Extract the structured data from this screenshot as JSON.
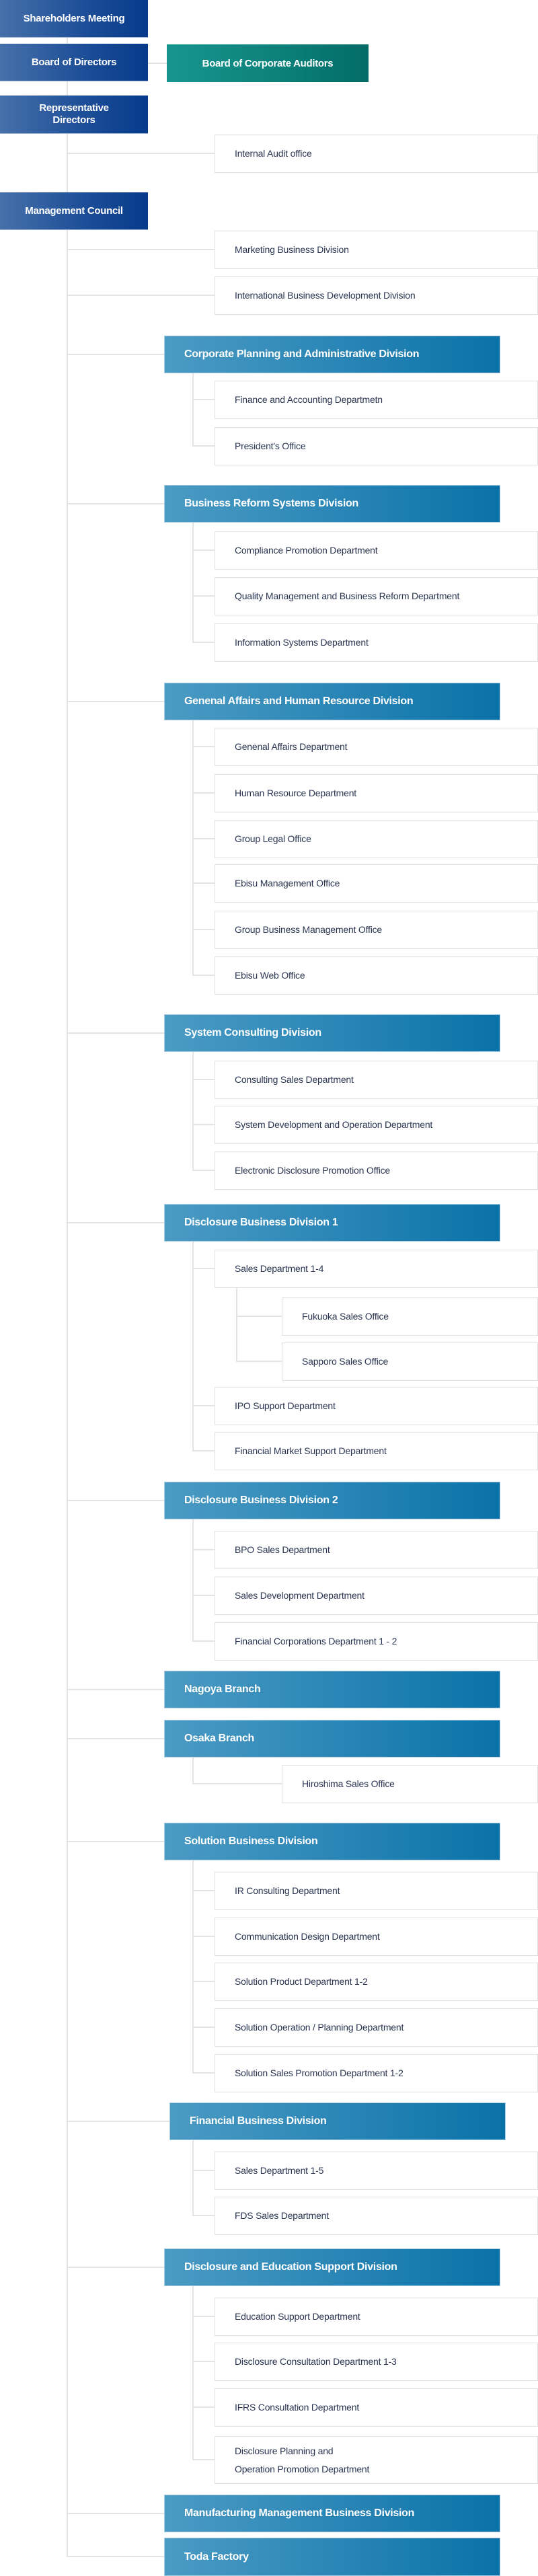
{
  "governance": {
    "shareholders": "Shareholders Meeting",
    "board": "Board of Directors",
    "auditors": "Board of Corporate Auditors",
    "representative": "Representative Directors",
    "internal_audit": "Internal Audit office",
    "management_council": "Management Council"
  },
  "management_direct": [
    "Marketing Business Division",
    "International Business Development Division"
  ],
  "divisions": [
    {
      "name": "Corporate Planning and Administrative Division",
      "departments": [
        "Finance and Accounting Departmetn",
        "President's Office"
      ]
    },
    {
      "name": "Business Reform Systems Division",
      "departments": [
        "Compliance Promotion Department",
        "Quality Management and Business Reform Department",
        "Information Systems Department"
      ]
    },
    {
      "name": "Genenal Affairs and Human Resource Division",
      "departments": [
        "Genenal Affairs Department",
        "Human Resource Department",
        "Group Legal Office",
        "Ebisu Management Office",
        "Group Business Management Office",
        "Ebisu Web Office"
      ]
    },
    {
      "name": "System Consulting Division",
      "departments": [
        "Consulting Sales Department",
        "System Development and Operation Department",
        "Electronic Disclosure Promotion Office"
      ]
    },
    {
      "name": "Disclosure Business Division 1",
      "departments": [
        "Sales Department 1-4",
        "IPO Support Department",
        "Financial Market Support Department"
      ],
      "sub_offices": [
        "Fukuoka Sales Office",
        "Sapporo Sales Office"
      ]
    },
    {
      "name": "Disclosure Business Division 2",
      "departments": [
        "BPO Sales Department",
        "Sales Development Department",
        "Financial Corporations Department 1 - 2"
      ]
    },
    {
      "name": "Nagoya Branch"
    },
    {
      "name": "Osaka Branch",
      "sub_offices": [
        "Hiroshima Sales Office"
      ]
    },
    {
      "name": "Solution Business Division",
      "departments": [
        "IR Consulting Department",
        "Communication Design Department",
        "Solution Product Department 1-2",
        "Solution Operation / Planning Department",
        "Solution Sales Promotion Department 1-2"
      ]
    },
    {
      "name": "Financial Business Division",
      "departments": [
        "Sales Department 1-5",
        "FDS Sales Department"
      ]
    },
    {
      "name": "Disclosure and Education Support Division",
      "departments": [
        "Education Support Department",
        "Disclosure Consultation Department 1-3",
        "IFRS Consultation Department",
        "Disclosure Planning and\nOperation Promotion Department"
      ]
    },
    {
      "name": "Manufacturing Management Business Division"
    },
    {
      "name": "Toda Factory"
    }
  ],
  "colors": {
    "governance": "#1e4f98",
    "auditors": "#0a7f78",
    "division": "#2b86b6",
    "connector": "#e4e4e4",
    "text": "#2b3551"
  }
}
